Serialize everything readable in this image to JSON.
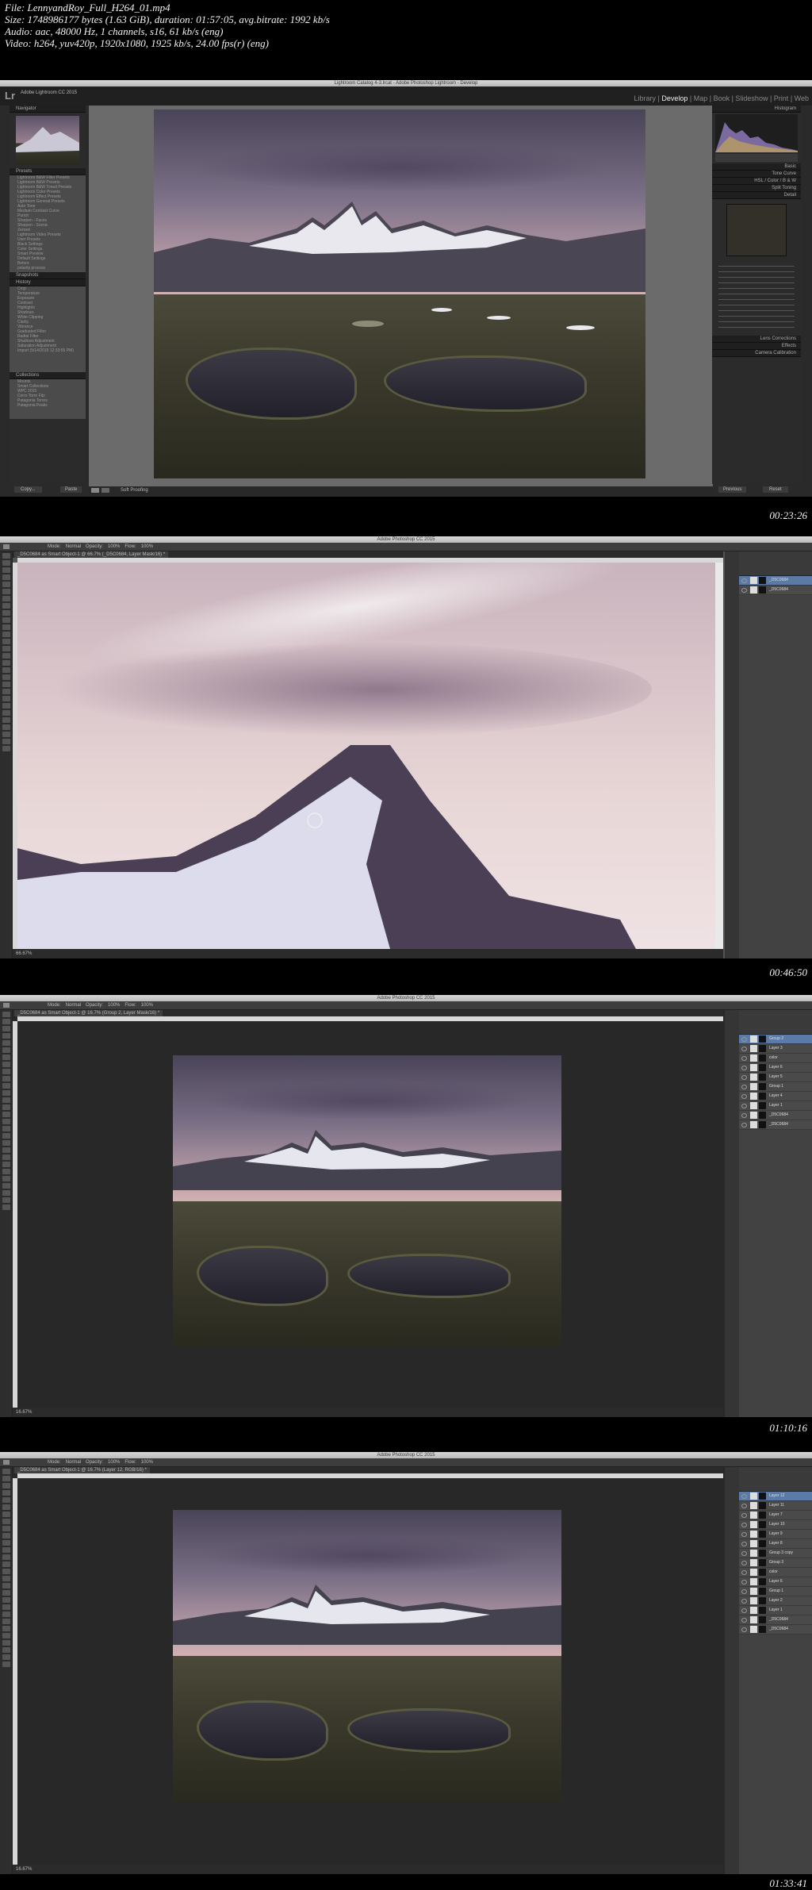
{
  "file_info": {
    "file": "File: LennyandRoy_Full_H264_01.mp4",
    "size": "Size: 1748986177 bytes (1.63 GiB), duration: 01:57:05, avg.bitrate: 1992 kb/s",
    "audio": "Audio: aac, 48000 Hz, 1 channels, s16, 61 kb/s (eng)",
    "video": "Video: h264, yuv420p, 1920x1080, 1925 kb/s, 24.00 fps(r) (eng)"
  },
  "frames": [
    {
      "timestamp": "00:23:26",
      "app": "Lightroom",
      "window_title": "Lightroom Catalog 4-3.lrcat - Adobe Photoshop Lightroom - Develop",
      "logo": "Lr",
      "identity": "Adobe Lightroom CC 2015",
      "modules": [
        "Library",
        "Develop",
        "Map",
        "Book",
        "Slideshow",
        "Print",
        "Web"
      ],
      "active_module": "Develop",
      "left_panels": {
        "navigator": "Navigator",
        "presets": "Presets",
        "preset_items": [
          "Lightroom B&W Filter Presets",
          "Lightroom B&W Presets",
          "Lightroom B&W Toned Presets",
          "Lightroom Color Presets",
          "Lightroom Effect Presets",
          "Lightroom General Presets",
          "Auto Tone",
          "Medium Contrast Curve",
          "Punch",
          "Sharpen - Faces",
          "Sharpen - Scenic",
          "Zeroed",
          "Lightroom Video Presets",
          "User Presets",
          "Black Settings",
          "Color Settings",
          "Smart Preview",
          "Default Settings",
          "Before",
          "polarity process"
        ],
        "snapshots": "Snapshots",
        "history": "History",
        "history_items": [
          "Crop",
          "Temperature",
          "Exposure",
          "Contrast",
          "Highlights",
          "Shadows",
          "White Clipping",
          "Clarity",
          "Vibrance",
          "Graduated Filter",
          "Radial Filter",
          "Shadows Adjustment",
          "Saturation Adjustment",
          "Import (5/14/2015 12:33:55 PM)"
        ],
        "collections": "Collections",
        "collection_items": [
          "Mounts",
          "Smart Collections",
          "WPC 2015",
          "Cerro Torre Fitz",
          "Patagonia Torres",
          "Patagonia Peaks"
        ],
        "copy_btn": "Copy...",
        "paste_btn": "Paste"
      },
      "right_panels": {
        "histogram": "Histogram",
        "sections": [
          "Basic",
          "Tone Curve",
          "HSL / Color / B & W",
          "Split Toning",
          "Detail",
          "Lens Corrections",
          "Effects",
          "Camera Calibration"
        ],
        "previous_btn": "Previous",
        "reset_btn": "Reset"
      },
      "toolbar": {
        "soft_proofing": "Soft Proofing"
      }
    },
    {
      "timestamp": "00:46:50",
      "app": "Photoshop",
      "window_title": "Adobe Photoshop CC 2015",
      "doc_tab": "_D5C0684 as Smart Object-1 @ 66.7% (_D5C0684, Layer Mask/16) *",
      "options": {
        "mode_label": "Mode:",
        "mode": "Normal",
        "opacity_label": "Opacity:",
        "opacity": "100%",
        "flow_label": "Flow:",
        "flow": "100%"
      },
      "status": "66.67%",
      "layers": [
        "_D5C0684",
        "_D5C0684"
      ]
    },
    {
      "timestamp": "01:10:16",
      "app": "Photoshop",
      "window_title": "Adobe Photoshop CC 2015",
      "doc_tab": "_D5C0684 as Smart Object-1 @ 16.7% (Group 2, Layer Mask/16) *",
      "options": {
        "mode_label": "Mode:",
        "mode": "Normal",
        "opacity_label": "Opacity:",
        "opacity": "100%",
        "flow_label": "Flow:",
        "flow": "100%"
      },
      "status": "16.67%",
      "layers": [
        "Group 2",
        "Layer 3",
        "color",
        "Layer 6",
        "Layer 5",
        "Group 1",
        "Layer 4",
        "Layer 1",
        "_D5C0684",
        "_D5C0684"
      ]
    },
    {
      "timestamp": "01:33:41",
      "app": "Photoshop",
      "window_title": "Adobe Photoshop CC 2015",
      "doc_tab": "_D5C0684 as Smart Object-1 @ 16.7% (Layer 12, RGB/16) *",
      "options": {
        "mode_label": "Mode:",
        "mode": "Normal",
        "opacity_label": "Opacity:",
        "opacity": "100%",
        "flow_label": "Flow:",
        "flow": "100%"
      },
      "status": "16.67%",
      "layers": [
        "Layer 12",
        "Layer 11",
        "Layer 7",
        "Layer 10",
        "Layer 9",
        "Layer 8",
        "Group 3 copy",
        "Group 3",
        "color",
        "Layer 6",
        "Group 1",
        "Layer 2",
        "Layer 1",
        "_D5C0684",
        "_D5C0684"
      ]
    }
  ]
}
